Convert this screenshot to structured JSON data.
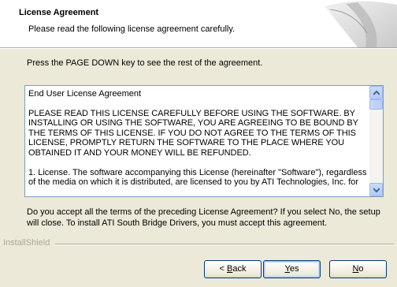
{
  "header": {
    "title": "License Agreement",
    "subtitle": "Please read the following license agreement carefully."
  },
  "instruction": "Press the PAGE DOWN key to see the rest of the agreement.",
  "license": {
    "heading": "End User License Agreement",
    "paragraph1": "PLEASE READ THIS LICENSE CAREFULLY BEFORE USING THE SOFTWARE. BY INSTALLING OR USING THE SOFTWARE, YOU ARE AGREEING TO BE BOUND BY THE TERMS OF THIS LICENSE.  IF YOU DO NOT AGREE TO THE TERMS OF THIS LICENSE, PROMPTLY RETURN THE SOFTWARE TO THE PLACE WHERE YOU OBTAINED IT AND YOUR MONEY WILL BE REFUNDED.",
    "paragraph2": "1. License.  The software accompanying this License (hereinafter \"Software\"), regardless of the media on which it is distributed, are licensed to you by ATI Technologies, Inc. for"
  },
  "question": "Do you accept all the terms of the preceding License Agreement?  If you select No,  the setup will close.  To install ATI South Bridge Drivers, you must accept this agreement.",
  "footer": {
    "brand": "InstallShield"
  },
  "buttons": {
    "back": {
      "prefix": "< ",
      "mnemonic": "B",
      "rest": "ack"
    },
    "yes": {
      "prefix": "",
      "mnemonic": "Y",
      "rest": "es"
    },
    "no": {
      "prefix": "",
      "mnemonic": "N",
      "rest": "o"
    }
  }
}
